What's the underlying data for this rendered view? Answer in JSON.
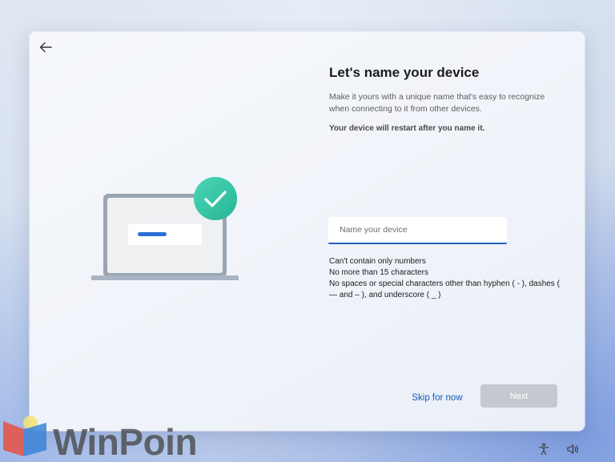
{
  "setup": {
    "title": "Let's name your device",
    "subtitle": "Make it yours with a unique name that's easy to recognize when connecting to it from other devices.",
    "restart_note": "Your device will restart after you name it.",
    "name_input": {
      "placeholder": "Name your device",
      "value": ""
    },
    "rules": [
      "Can't contain only numbers",
      "No more than 15 characters",
      "No spaces or special characters other than hyphen ( - ), dashes ( — and – ), and underscore ( _ )"
    ],
    "skip_label": "Skip for now",
    "next_label": "Next"
  },
  "watermark": {
    "text": "WinPoin"
  },
  "icons": {
    "back": "back-arrow-icon",
    "illustration": "laptop-check-illustration",
    "accessibility": "accessibility-icon",
    "volume": "volume-icon"
  },
  "colors": {
    "accent": "#1d62b9",
    "link": "#1459b8",
    "check_badge": "#2fc8a5",
    "next_disabled": "#c5c9cf"
  }
}
